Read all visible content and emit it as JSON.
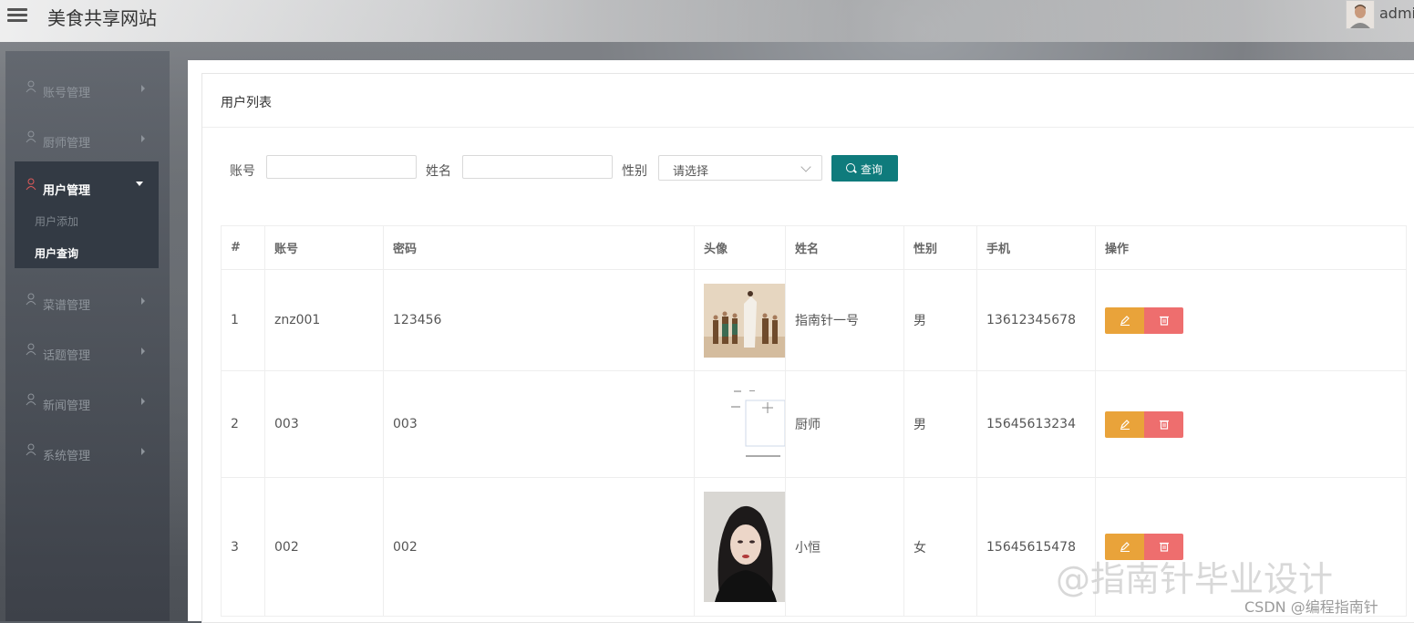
{
  "app": {
    "title": "美食共享网站",
    "user": "admi"
  },
  "sidebar": {
    "items": [
      {
        "label": "账号管理"
      },
      {
        "label": "厨师管理"
      },
      {
        "label": "用户管理",
        "active": true
      },
      {
        "label": "菜谱管理"
      },
      {
        "label": "话题管理"
      },
      {
        "label": "新闻管理"
      },
      {
        "label": "系统管理"
      }
    ],
    "sub_items": [
      {
        "label": "用户添加"
      },
      {
        "label": "用户查询",
        "active": true
      }
    ],
    "active_icon_color": "#e05a5a"
  },
  "card": {
    "title": "用户列表"
  },
  "search": {
    "account_label": "账号",
    "account_value": "",
    "name_label": "姓名",
    "name_value": "",
    "gender_label": "性别",
    "gender_placeholder": "请选择",
    "query_label": "查询"
  },
  "table": {
    "columns": [
      "#",
      "账号",
      "密码",
      "头像",
      "姓名",
      "性别",
      "手机",
      "操作"
    ],
    "rows": [
      {
        "no": "1",
        "account": "znz001",
        "password": "123456",
        "avatar": "group-photo",
        "name": "指南针一号",
        "gender": "男",
        "phone": "13612345678"
      },
      {
        "no": "2",
        "account": "003",
        "password": "003",
        "avatar": "form-screenshot",
        "name": "厨师",
        "gender": "男",
        "phone": "15645613234"
      },
      {
        "no": "3",
        "account": "002",
        "password": "002",
        "avatar": "portrait-photo",
        "name": "小恒",
        "gender": "女",
        "phone": "15645615478"
      }
    ]
  },
  "colors": {
    "query_button": "#0f7b7c",
    "edit_button": "#e9a33a",
    "delete_button": "#ee6e6e"
  },
  "watermark": {
    "main": "@指南针毕业设计",
    "sub": "CSDN @编程指南针"
  }
}
